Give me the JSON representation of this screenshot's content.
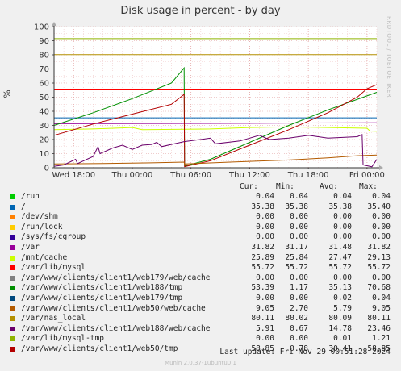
{
  "title": "Disk usage in percent - by day",
  "watermark": "RRDTOOL / TOBI OETIKER",
  "footer": {
    "last_update": "Last update: Fri Nov 29 00:51:28 2024",
    "munin": "Munin 2.0.37-1ubuntu0.1"
  },
  "legend_headers": {
    "cur": "Cur:",
    "min": "Min:",
    "avg": "Avg:",
    "max": "Max:"
  },
  "legend": [
    {
      "name": "/run",
      "color": "#00cc00",
      "cur": "0.04",
      "min": "0.04",
      "avg": "0.04",
      "max": "0.04"
    },
    {
      "name": "/",
      "color": "#0066b3",
      "cur": "35.38",
      "min": "35.38",
      "avg": "35.38",
      "max": "35.40"
    },
    {
      "name": "/dev/shm",
      "color": "#ff8000",
      "cur": "0.00",
      "min": "0.00",
      "avg": "0.00",
      "max": "0.00"
    },
    {
      "name": "/run/lock",
      "color": "#ffcc00",
      "cur": "0.00",
      "min": "0.00",
      "avg": "0.00",
      "max": "0.00"
    },
    {
      "name": "/sys/fs/cgroup",
      "color": "#330099",
      "cur": "0.00",
      "min": "0.00",
      "avg": "0.00",
      "max": "0.00"
    },
    {
      "name": "/var",
      "color": "#990099",
      "cur": "31.82",
      "min": "31.17",
      "avg": "31.48",
      "max": "31.82"
    },
    {
      "name": "/mnt/cache",
      "color": "#ccff00",
      "cur": "25.89",
      "min": "25.84",
      "avg": "27.47",
      "max": "29.13"
    },
    {
      "name": "/var/lib/mysql",
      "color": "#ff0000",
      "cur": "55.72",
      "min": "55.72",
      "avg": "55.72",
      "max": "55.72"
    },
    {
      "name": "/var/www/clients/client1/web179/web/cache",
      "color": "#808080",
      "cur": "0.00",
      "min": "0.00",
      "avg": "0.00",
      "max": "0.00"
    },
    {
      "name": "/var/www/clients/client1/web188/tmp",
      "color": "#008f00",
      "cur": "53.39",
      "min": "1.17",
      "avg": "35.13",
      "max": "70.68"
    },
    {
      "name": "/var/www/clients/client1/web179/tmp",
      "color": "#00487d",
      "cur": "0.00",
      "min": "0.00",
      "avg": "0.02",
      "max": "0.04"
    },
    {
      "name": "/var/www/clients/client1/web50/web/cache",
      "color": "#b35a00",
      "cur": "9.05",
      "min": "2.70",
      "avg": "5.79",
      "max": "9.05"
    },
    {
      "name": "/var/nas_local",
      "color": "#b38f00",
      "cur": "80.11",
      "min": "80.02",
      "avg": "80.09",
      "max": "80.11"
    },
    {
      "name": "/var/www/clients/client1/web188/web/cache",
      "color": "#6b006b",
      "cur": "5.91",
      "min": "0.67",
      "avg": "14.78",
      "max": "23.46"
    },
    {
      "name": "/var/lib/mysql-tmp",
      "color": "#8fb300",
      "cur": "0.00",
      "min": "0.00",
      "avg": "0.01",
      "max": "1.21"
    },
    {
      "name": "/var/www/clients/client1/web50/tmp",
      "color": "#b30000",
      "cur": "58.85",
      "min": "0.78",
      "avg": "30.41",
      "max": "58.85"
    }
  ],
  "chart_data": {
    "type": "line",
    "title": "Disk usage in percent - by day",
    "ylabel": "%",
    "ylim": [
      0,
      100
    ],
    "yticks": [
      0,
      10,
      20,
      30,
      40,
      50,
      60,
      70,
      80,
      90,
      100
    ],
    "xlim": [
      0,
      33
    ],
    "xticks": [
      {
        "x": 2,
        "label": "Wed 18:00"
      },
      {
        "x": 8,
        "label": "Thu 00:00"
      },
      {
        "x": 14,
        "label": "Thu 06:00"
      },
      {
        "x": 20,
        "label": "Thu 12:00"
      },
      {
        "x": 26,
        "label": "Thu 18:00"
      },
      {
        "x": 32,
        "label": "Fri 00:00"
      }
    ],
    "grid": true,
    "series": [
      {
        "name": "/",
        "color": "#0066b3",
        "points": [
          [
            0,
            35.4
          ],
          [
            33,
            35.4
          ]
        ]
      },
      {
        "name": "/var/nas_local",
        "color": "#b38f00",
        "points": [
          [
            0,
            80.1
          ],
          [
            33,
            80.1
          ]
        ]
      },
      {
        "name": "/var/lib/mysql",
        "color": "#ff0000",
        "points": [
          [
            0,
            55.7
          ],
          [
            33,
            55.7
          ]
        ]
      },
      {
        "name": "/var",
        "color": "#990099",
        "points": [
          [
            0,
            31.2
          ],
          [
            20,
            31.5
          ],
          [
            26,
            31.7
          ],
          [
            33,
            31.8
          ]
        ]
      },
      {
        "name": "/mnt/cache",
        "color": "#ccff00",
        "points": [
          [
            0,
            27
          ],
          [
            4,
            27.5
          ],
          [
            8,
            28.5
          ],
          [
            9,
            27
          ],
          [
            16,
            27.5
          ],
          [
            18,
            28
          ],
          [
            20,
            28.5
          ],
          [
            24,
            29
          ],
          [
            28,
            28.5
          ],
          [
            32,
            28
          ],
          [
            32.3,
            26
          ],
          [
            33,
            25.9
          ]
        ]
      },
      {
        "name": "/var/www/clients/client1/web188/tmp",
        "color": "#008f00",
        "points": [
          [
            0,
            30
          ],
          [
            4,
            39
          ],
          [
            8,
            49
          ],
          [
            12,
            60
          ],
          [
            13.3,
            70.7
          ],
          [
            13.35,
            1.2
          ],
          [
            16,
            6
          ],
          [
            20,
            18
          ],
          [
            24,
            30
          ],
          [
            28,
            41
          ],
          [
            33,
            53.4
          ]
        ]
      },
      {
        "name": "/var/www/clients/client1/web50/tmp",
        "color": "#b30000",
        "points": [
          [
            0,
            23
          ],
          [
            4,
            31
          ],
          [
            8,
            38
          ],
          [
            12,
            45
          ],
          [
            13.3,
            52
          ],
          [
            13.35,
            0.8
          ],
          [
            16,
            5
          ],
          [
            20,
            16
          ],
          [
            24,
            27
          ],
          [
            28,
            39
          ],
          [
            31,
            50
          ],
          [
            32,
            56
          ],
          [
            33,
            58.9
          ]
        ]
      },
      {
        "name": "/var/www/clients/client1/web50/web/cache",
        "color": "#b35a00",
        "points": [
          [
            0,
            2.7
          ],
          [
            5,
            3
          ],
          [
            10,
            3.5
          ],
          [
            13.3,
            4
          ],
          [
            13.35,
            2.7
          ],
          [
            18,
            4
          ],
          [
            24,
            5.5
          ],
          [
            28,
            7
          ],
          [
            31,
            8.5
          ],
          [
            33,
            9.05
          ]
        ]
      },
      {
        "name": "/var/www/clients/client1/web188/web/cache",
        "color": "#6b006b",
        "points": [
          [
            0,
            1
          ],
          [
            1,
            2
          ],
          [
            2.2,
            6
          ],
          [
            2.4,
            3
          ],
          [
            4,
            8
          ],
          [
            4.5,
            15
          ],
          [
            4.7,
            10
          ],
          [
            6,
            14
          ],
          [
            7,
            16
          ],
          [
            8,
            13
          ],
          [
            9,
            16
          ],
          [
            10,
            16.5
          ],
          [
            10.5,
            18
          ],
          [
            11,
            15
          ],
          [
            13.3,
            18.5
          ],
          [
            16,
            21
          ],
          [
            16.5,
            17
          ],
          [
            19,
            19
          ],
          [
            21,
            23
          ],
          [
            22,
            20
          ],
          [
            24,
            21
          ],
          [
            26,
            23
          ],
          [
            28,
            21
          ],
          [
            31,
            22
          ],
          [
            31.5,
            23.5
          ],
          [
            31.6,
            2
          ],
          [
            32.5,
            0.7
          ],
          [
            33,
            5.9
          ]
        ]
      },
      {
        "name": "/var/lib/mysql-tmp",
        "color": "#8fb300",
        "points": [
          [
            0,
            91.5
          ],
          [
            33,
            91.5
          ]
        ]
      }
    ]
  }
}
